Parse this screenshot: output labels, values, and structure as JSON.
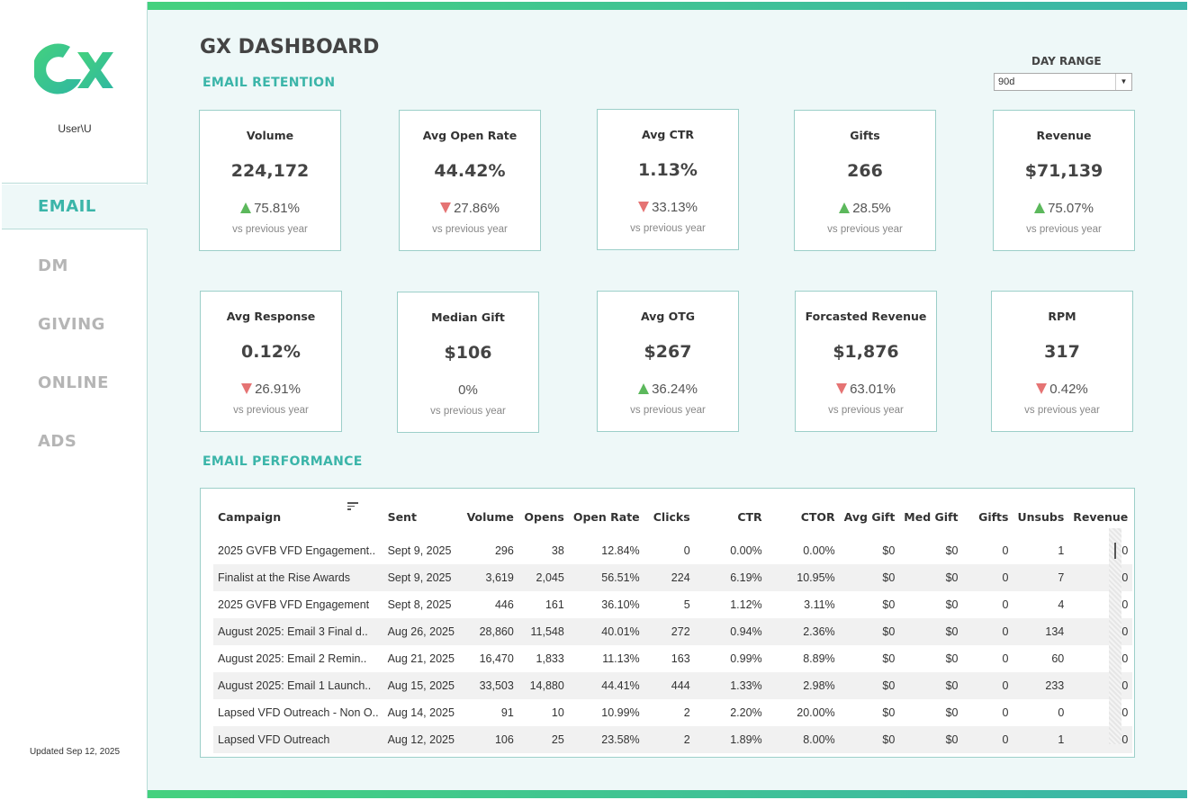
{
  "sidebar": {
    "user": "User\\U",
    "nav": [
      {
        "label": "EMAIL",
        "active": true
      },
      {
        "label": "DM"
      },
      {
        "label": "GIVING"
      },
      {
        "label": "ONLINE"
      },
      {
        "label": "ADS"
      }
    ],
    "updated": "Updated Sep 12, 2025"
  },
  "header": {
    "title": "GX DASHBOARD",
    "retention_title": "EMAIL RETENTION",
    "performance_title": "EMAIL PERFORMANCE"
  },
  "day_range": {
    "label": "DAY RANGE",
    "value": "90d"
  },
  "colors": {
    "accent": "#3bb5a9",
    "brand_green": "#44d17e",
    "up": "#5cb85c",
    "down": "#e57373"
  },
  "kpis": [
    {
      "label": "Volume",
      "value": "224,172",
      "change": "75.81%",
      "direction": "up",
      "sub": "vs previous year"
    },
    {
      "label": "Avg Open Rate",
      "value": "44.42%",
      "change": "27.86%",
      "direction": "down",
      "sub": "vs previous year"
    },
    {
      "label": "Avg CTR",
      "value": "1.13%",
      "change": "33.13%",
      "direction": "down",
      "sub": "vs previous year"
    },
    {
      "label": "Gifts",
      "value": "266",
      "change": "28.5%",
      "direction": "up",
      "sub": "vs previous year"
    },
    {
      "label": "Revenue",
      "value": "$71,139",
      "change": "75.07%",
      "direction": "up",
      "sub": "vs previous year"
    },
    {
      "label": "Avg Response",
      "value": "0.12%",
      "change": "26.91%",
      "direction": "down",
      "sub": "vs previous year"
    },
    {
      "label": "Median Gift",
      "value": "$106",
      "change": "0%",
      "direction": "none",
      "sub": "vs previous year"
    },
    {
      "label": "Avg OTG",
      "value": "$267",
      "change": "36.24%",
      "direction": "up",
      "sub": "vs previous year"
    },
    {
      "label": "Forcasted Revenue",
      "value": "$1,876",
      "change": "63.01%",
      "direction": "down",
      "sub": "vs previous year"
    },
    {
      "label": "RPM",
      "value": "317",
      "change": "0.42%",
      "direction": "down",
      "sub": "vs previous year"
    }
  ],
  "table": {
    "columns": [
      "Campaign",
      "Sent",
      "Volume",
      "Opens",
      "Open Rate",
      "Clicks",
      "CTR",
      "CTOR",
      "Avg Gift",
      "Med Gift",
      "Gifts",
      "Unsubs",
      "Revenue"
    ],
    "rows": [
      [
        "2025 GVFB VFD Engagement..",
        "Sept 9, 2025",
        "296",
        "38",
        "12.84%",
        "0",
        "0.00%",
        "0.00%",
        "$0",
        "$0",
        "0",
        "1",
        "$0"
      ],
      [
        "Finalist at the Rise Awards",
        "Sept 9, 2025",
        "3,619",
        "2,045",
        "56.51%",
        "224",
        "6.19%",
        "10.95%",
        "$0",
        "$0",
        "0",
        "7",
        "$0"
      ],
      [
        "2025 GVFB VFD Engagement",
        "Sept 8, 2025",
        "446",
        "161",
        "36.10%",
        "5",
        "1.12%",
        "3.11%",
        "$0",
        "$0",
        "0",
        "4",
        "$0"
      ],
      [
        "August 2025: Email 3 Final d..",
        "Aug 26, 2025",
        "28,860",
        "11,548",
        "40.01%",
        "272",
        "0.94%",
        "2.36%",
        "$0",
        "$0",
        "0",
        "134",
        "$0"
      ],
      [
        "August 2025: Email 2 Remin..",
        "Aug 21, 2025",
        "16,470",
        "1,833",
        "11.13%",
        "163",
        "0.99%",
        "8.89%",
        "$0",
        "$0",
        "0",
        "60",
        "$0"
      ],
      [
        "August 2025: Email 1 Launch..",
        "Aug 15, 2025",
        "33,503",
        "14,880",
        "44.41%",
        "444",
        "1.33%",
        "2.98%",
        "$0",
        "$0",
        "0",
        "233",
        "$0"
      ],
      [
        "Lapsed VFD Outreach - Non O..",
        "Aug 14, 2025",
        "91",
        "10",
        "10.99%",
        "2",
        "2.20%",
        "20.00%",
        "$0",
        "$0",
        "0",
        "0",
        "$0"
      ],
      [
        "Lapsed VFD Outreach",
        "Aug 12, 2025",
        "106",
        "25",
        "23.58%",
        "2",
        "1.89%",
        "8.00%",
        "$0",
        "$0",
        "0",
        "1",
        "$0"
      ]
    ]
  }
}
